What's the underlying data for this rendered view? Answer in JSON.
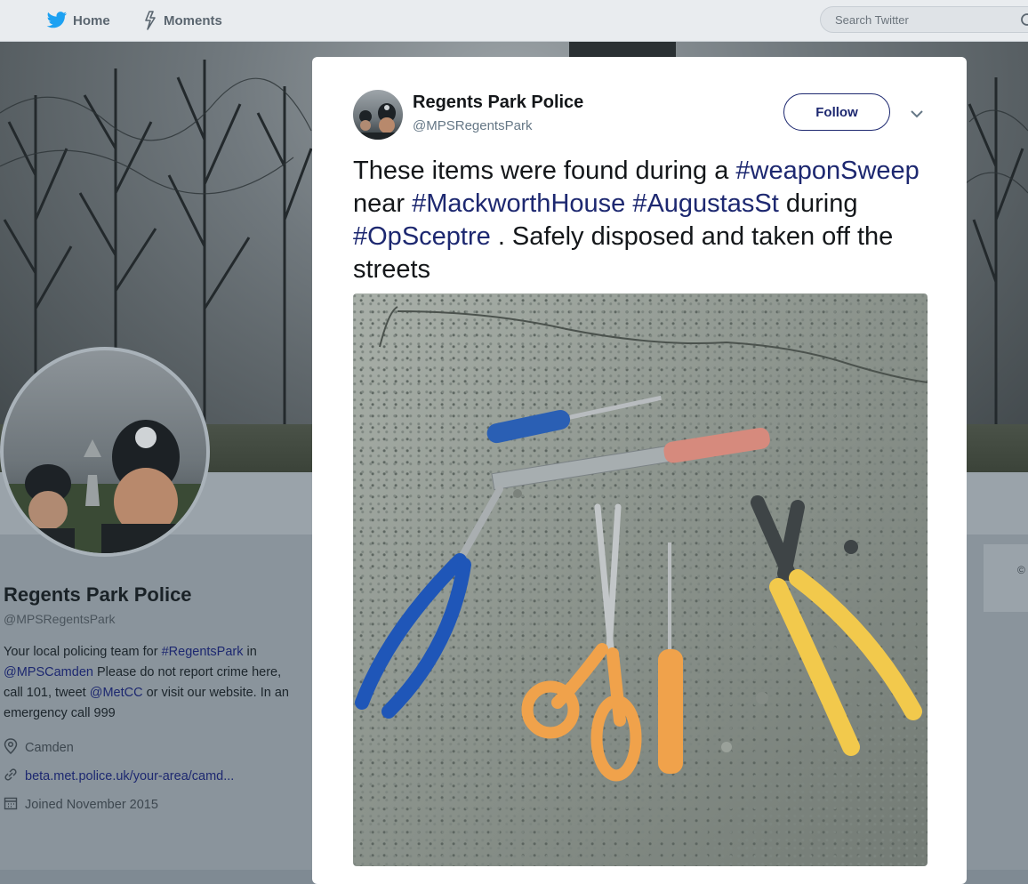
{
  "nav": {
    "home_label": "Home",
    "moments_label": "Moments",
    "search_placeholder": "Search Twitter"
  },
  "profile": {
    "name": "Regents Park Police",
    "handle": "@MPSRegentsPark",
    "bio_parts": {
      "p1": "Your local policing team for ",
      "tag1": "#RegentsPark",
      "p2": " in ",
      "mention1": "@MPSCamden",
      "p3": " Please do not report crime here, call 101, tweet ",
      "mention2": "@MetCC",
      "p4": " or visit our website. In an emergency call 999"
    },
    "location": "Camden",
    "url": "beta.met.police.uk/your-area/camd...",
    "joined": "Joined November 2015",
    "right_card_glyph": "©"
  },
  "tweet": {
    "author_name": "Regents Park Police",
    "author_handle": "@MPSRegentsPark",
    "follow_label": "Follow",
    "text": {
      "t1": "These items were found during a ",
      "h1": "#weaponSweep",
      "t2": " near ",
      "h2": "#MackworthHouse",
      "t3": " ",
      "h3": "#AugustasSt",
      "t4": " during ",
      "h4": "#OpSceptre",
      "t5": " . Safely disposed and taken off the streets"
    }
  },
  "colors": {
    "link": "#1d2870",
    "twitter_blue": "#1da1f2"
  }
}
